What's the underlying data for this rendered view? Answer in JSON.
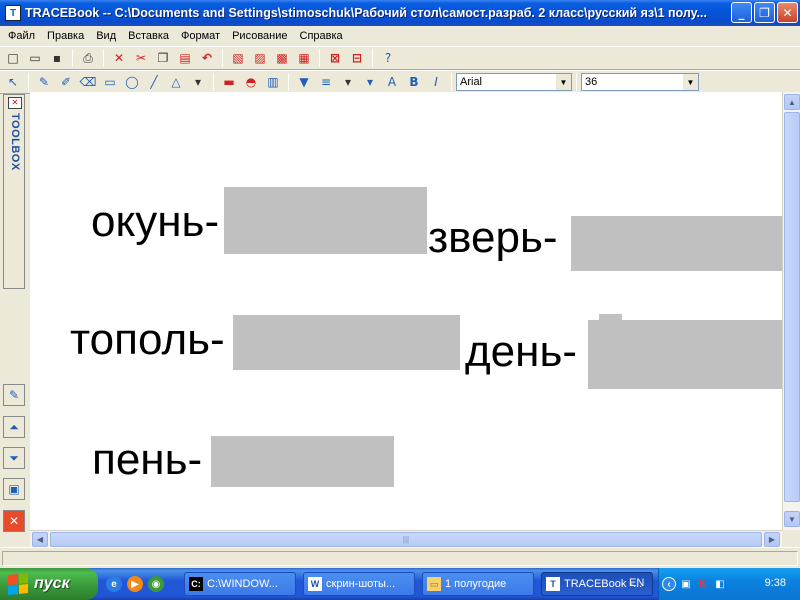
{
  "window": {
    "title": "TRACEBook -- C:\\Documents and Settings\\stimoschuk\\Рабочий стол\\самост.разраб. 2 класс\\русский яз\\1 полу...",
    "app_icon": "tracebook-app-icon",
    "controls": {
      "minimize": "_",
      "maximize": "❐",
      "close": "✕"
    }
  },
  "menu": [
    "Файл",
    "Правка",
    "Вид",
    "Вставка",
    "Формат",
    "Рисование",
    "Справка"
  ],
  "toolbar2": {
    "font_name": "Arial",
    "font_size": "36",
    "bold": "B",
    "italic": "I",
    "text_tool": "A"
  },
  "toolbox": {
    "label": "TOOLBOX"
  },
  "canvas": {
    "words": [
      "окунь-",
      "зверь-",
      "тополь-",
      "день-",
      "пень-"
    ],
    "box_color": "#c0c0c0"
  },
  "taskbar": {
    "start_label": "пуск",
    "tasks": [
      {
        "label": "C:\\WINDOW...",
        "icon": "cmd-icon"
      },
      {
        "label": "скрин-шоты...",
        "icon": "word-doc-icon"
      },
      {
        "label": "1 полугодие",
        "icon": "folder-icon"
      },
      {
        "label": "TRACEBook -...",
        "icon": "tracebook-icon",
        "active": true
      }
    ],
    "language": "EN",
    "clock": "9:38"
  }
}
